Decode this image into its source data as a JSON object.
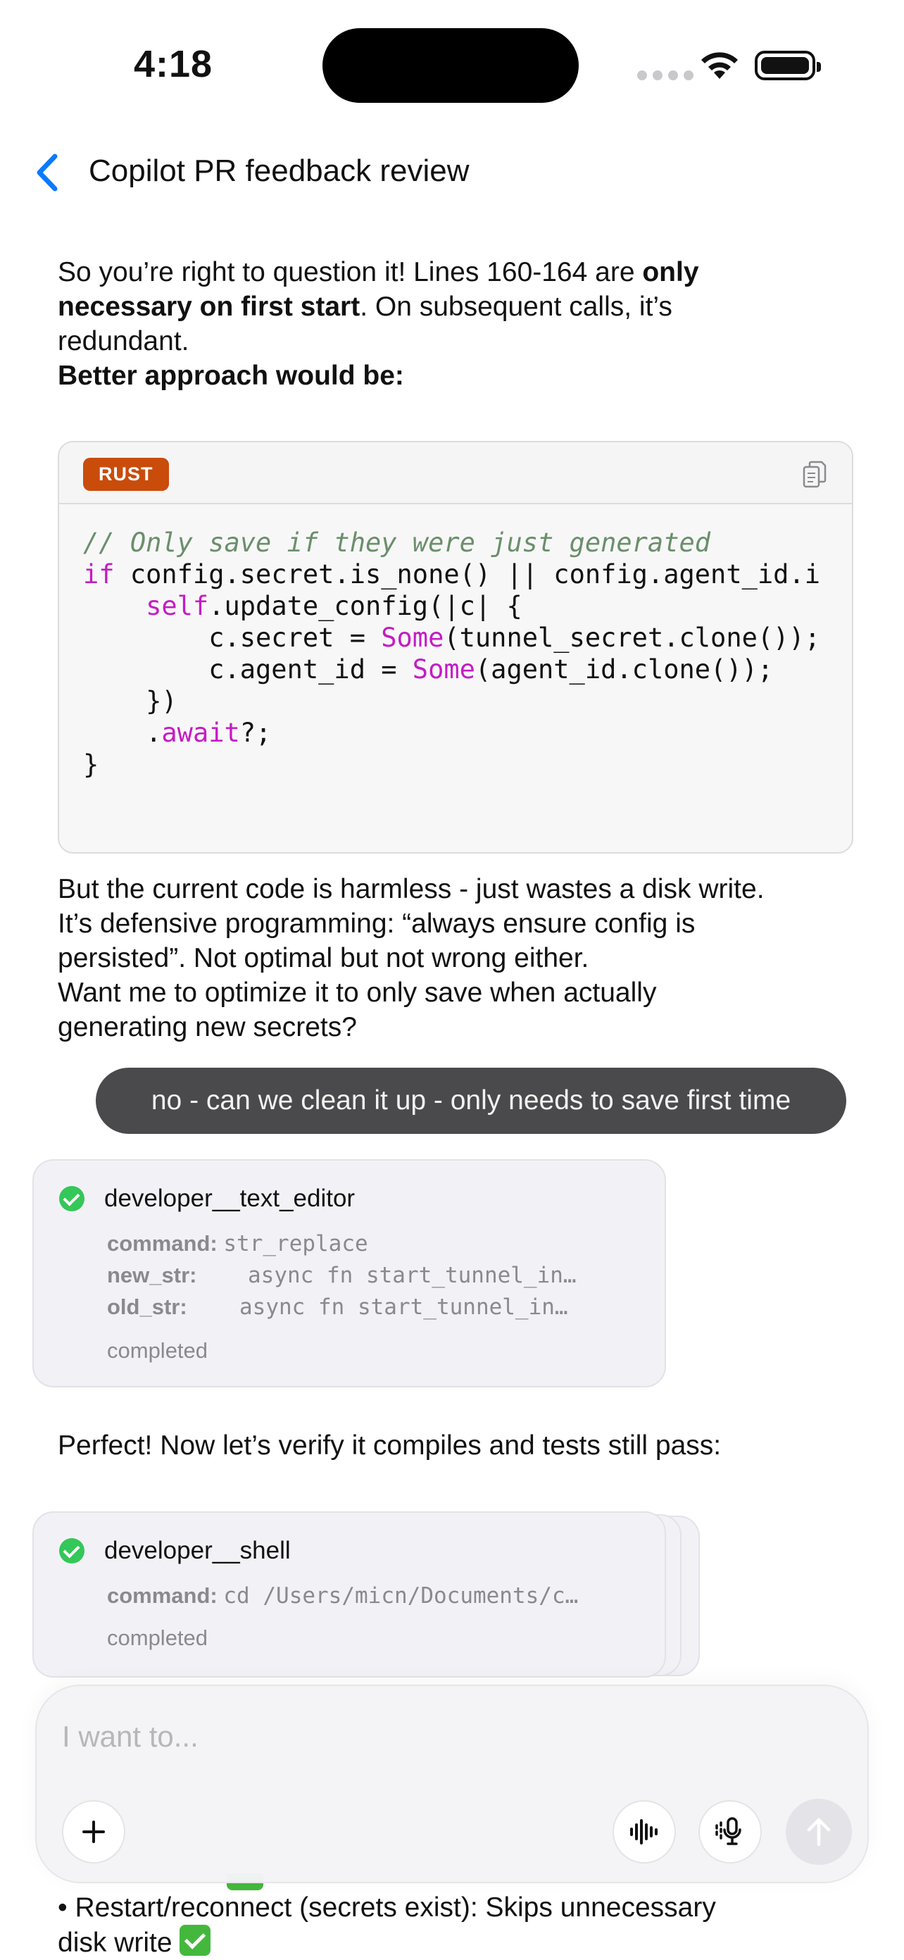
{
  "status_bar": {
    "time": "4:18"
  },
  "nav": {
    "title": "Copilot PR feedback review"
  },
  "message1": {
    "line1_a": "So you’re right to question it! Lines 160-164 are ",
    "line1_b": "only",
    "line2_a": "necessary on first start",
    "line2_b": ". On subsequent calls, it’s",
    "line3": "redundant.",
    "line4": "Better approach would be:"
  },
  "code_block": {
    "language": "RUST",
    "line1": "// Only save if they were just generated",
    "line2_kw": "if",
    "line2_rest": " config.secret.is_none() || config.agent_id.i",
    "line3_kw": "self",
    "line3_rest": ".update_config(|c| {",
    "line4_a": "        c.secret = ",
    "line4_kw": "Some",
    "line4_b": "(tunnel_secret.clone());",
    "line5_a": "        c.agent_id = ",
    "line5_kw": "Some",
    "line5_b": "(agent_id.clone());",
    "line6": "    })",
    "line7_a": "    .",
    "line7_kw": "await",
    "line7_b": "?;",
    "line8": "}"
  },
  "message2": {
    "line1": "But the current code is harmless - just wastes a disk write.",
    "line2": "It’s defensive programming: “always ensure config is",
    "line3": "persisted”. Not optimal but not wrong either.",
    "line4": "Want me to optimize it to only save when actually",
    "line5": "generating new secrets?"
  },
  "user_message": "no - can we clean it up - only needs to save first time",
  "tool1": {
    "name": "developer__text_editor",
    "command_key": "command:",
    "command_val": "str_replace",
    "new_key": "new_str:",
    "new_val": "async fn start_tunnel_in…",
    "old_key": "old_str:",
    "old_val": "async fn start_tunnel_in…",
    "status": "completed"
  },
  "message3": "Perfect! Now let’s verify it compiles and tests still pass:",
  "tool2": {
    "name": "developer__shell",
    "command_key": "command:",
    "command_val": "cd /Users/micn/Documents/c…",
    "status": "completed"
  },
  "composer": {
    "placeholder": "I want to..."
  },
  "footer_text": {
    "line1": "• Restart/reconnect (secrets exist): Skips unnecessary",
    "line2": "disk write"
  },
  "icons": [
    "back-chevron-icon",
    "wifi-icon",
    "battery-icon",
    "copy-icon",
    "check-circle-icon",
    "plus-icon",
    "waveform-icon",
    "microphone-icon",
    "send-arrow-icon",
    "check-mark-emoji-icon"
  ],
  "colors": {
    "accent": "#0a7aff",
    "rust_badge": "#c94c0b",
    "keyword": "#c41cc4",
    "success": "#34c759",
    "user_bubble": "#4a4a4c"
  }
}
